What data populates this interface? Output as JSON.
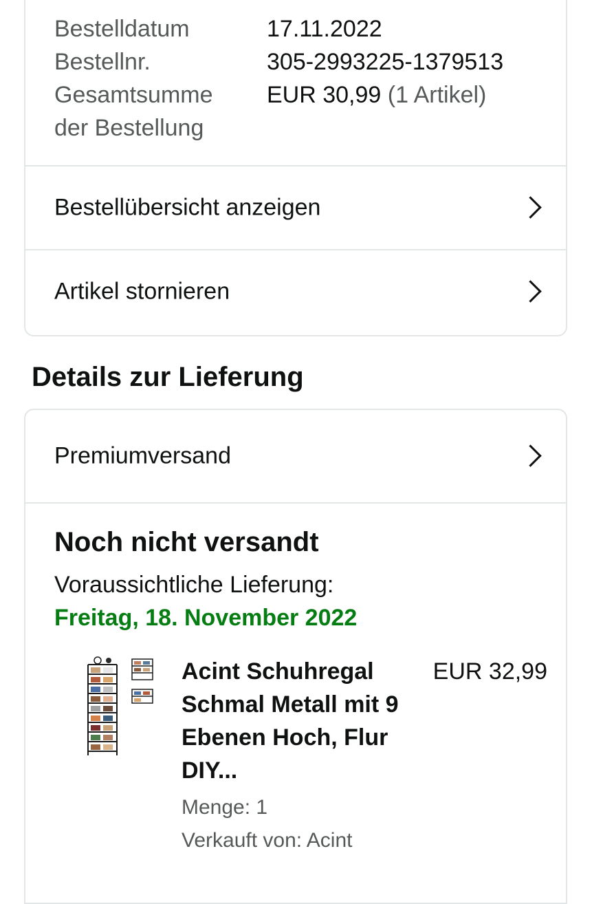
{
  "order_info": {
    "rows": [
      {
        "label": "Bestelldatum",
        "value": "17.11.2022"
      },
      {
        "label": "Bestellnr.",
        "value": "305-2993225-1379513"
      },
      {
        "label": "Gesamtsumme der Bestellung",
        "value": "EUR 30,99",
        "value_suffix": "(1 Artikel)"
      }
    ]
  },
  "order_actions": {
    "view_summary": "Bestellübersicht anzeigen",
    "cancel_items": "Artikel stornieren"
  },
  "delivery": {
    "section_title": "Details zur Lieferung",
    "shipping_method": "Premiumversand",
    "status": "Noch nicht versandt",
    "expected_label": "Voraussichtliche Lieferung:",
    "expected_date": "Freitag, 18. November 2022",
    "expected_date_color": "#067d12",
    "item": {
      "image_icon": "shoe-rack-product-image",
      "title": "Acint Schuhregal Schmal Metall mit 9 Ebenen Hoch, Flur DIY...",
      "price": "EUR 32,99",
      "quantity": "Menge: 1",
      "seller": "Verkauft von: Acint"
    }
  }
}
